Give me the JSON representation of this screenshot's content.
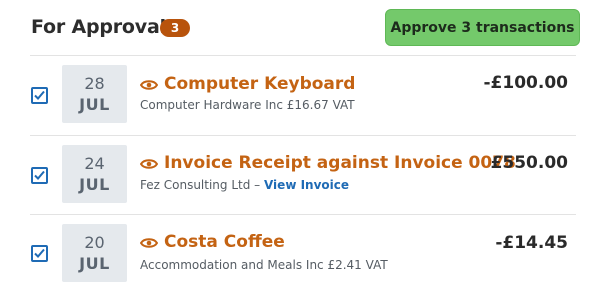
{
  "header": {
    "title": "For Approval",
    "count": "3",
    "approve_label": "Approve 3 transactions"
  },
  "colors": {
    "accent_orange": "#c46313",
    "badge": "#b8530c",
    "approve_green": "#74c96b",
    "link_blue": "#1f6bb5"
  },
  "transactions": [
    {
      "checked": true,
      "day": "28",
      "month": "JUL",
      "title": "Computer Keyboard",
      "subtitle": "Computer Hardware Inc £16.67 VAT",
      "amount": "-£100.00",
      "icon": "eye-icon"
    },
    {
      "checked": true,
      "day": "24",
      "month": "JUL",
      "title": "Invoice Receipt against Invoice 0078",
      "subtitle_prefix": "Fez Consulting Ltd – ",
      "subtitle_link": "View Invoice",
      "amount": "£550.00",
      "icon": "eye-icon"
    },
    {
      "checked": true,
      "day": "20",
      "month": "JUL",
      "title": "Costa Coffee",
      "subtitle": "Accommodation and Meals Inc £2.41 VAT",
      "amount": "-£14.45",
      "icon": "eye-icon"
    }
  ]
}
